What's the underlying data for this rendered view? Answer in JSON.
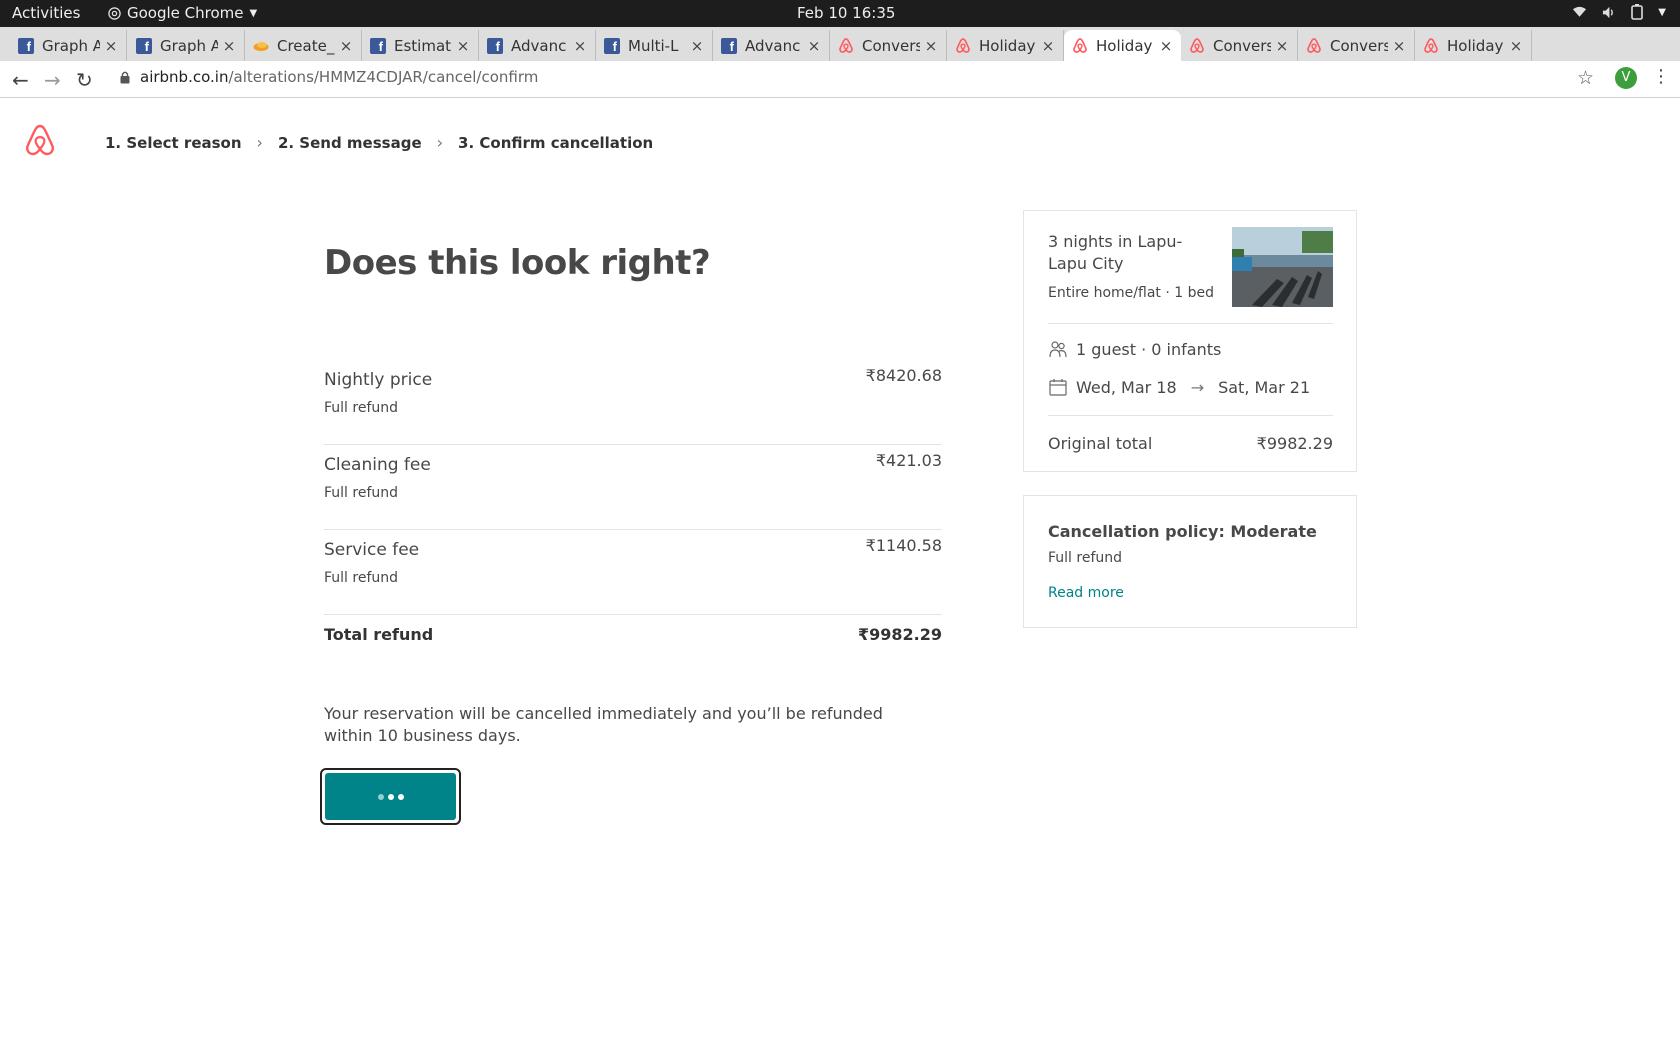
{
  "os_bar": {
    "activities": "Activities",
    "app_name": "Google Chrome",
    "clock": "Feb 10  16:35"
  },
  "tabs": [
    {
      "title": "Graph A",
      "icon": "facebook-icon",
      "active": false
    },
    {
      "title": "Graph A",
      "icon": "facebook-icon",
      "active": false
    },
    {
      "title": "Create_",
      "icon": "app-icon",
      "active": false
    },
    {
      "title": "Estimat",
      "icon": "facebook-icon",
      "active": false
    },
    {
      "title": "Advanc",
      "icon": "facebook-icon",
      "active": false
    },
    {
      "title": "Multi-L",
      "icon": "facebook-icon",
      "active": false
    },
    {
      "title": "Advanc",
      "icon": "facebook-icon",
      "active": false
    },
    {
      "title": "Convers",
      "icon": "airbnb-icon",
      "active": false
    },
    {
      "title": "Holiday",
      "icon": "airbnb-icon",
      "active": false
    },
    {
      "title": "Holiday",
      "icon": "airbnb-icon",
      "active": true
    },
    {
      "title": "Convers",
      "icon": "airbnb-icon",
      "active": false
    },
    {
      "title": "Convers",
      "icon": "airbnb-icon",
      "active": false
    },
    {
      "title": "Holiday",
      "icon": "airbnb-icon",
      "active": false
    }
  ],
  "address_bar": {
    "host": "airbnb.co.in",
    "path": "/alterations/HMMZ4CDJAR/cancel/confirm"
  },
  "profile_initial": "V",
  "steps": [
    "1. Select reason",
    "2. Send message",
    "3. Confirm cancellation"
  ],
  "heading": "Does this look right?",
  "line_items": [
    {
      "label": "Nightly price",
      "sub": "Full refund",
      "amount": "₹8420.68"
    },
    {
      "label": "Cleaning fee",
      "sub": "Full refund",
      "amount": "₹421.03"
    },
    {
      "label": "Service fee",
      "sub": "Full refund",
      "amount": "₹1140.58"
    }
  ],
  "total": {
    "label": "Total refund",
    "amount": "₹9982.29"
  },
  "notice": "Your reservation will be cancelled immediately and you’ll be refunded within 10 business days.",
  "trip": {
    "title": "3 nights in Lapu-Lapu City",
    "subtitle": "Entire home/flat · 1 bed",
    "guests": "1 guest · 0 infants",
    "check_in": "Wed, Mar 18",
    "check_out": "Sat, Mar 21",
    "original_total_label": "Original total",
    "original_total": "₹9982.29"
  },
  "policy": {
    "title": "Cancellation policy: Moderate",
    "subtitle": "Full refund",
    "link": "Read more"
  },
  "colors": {
    "brand": "#FF5A5F",
    "teal": "#008489"
  }
}
